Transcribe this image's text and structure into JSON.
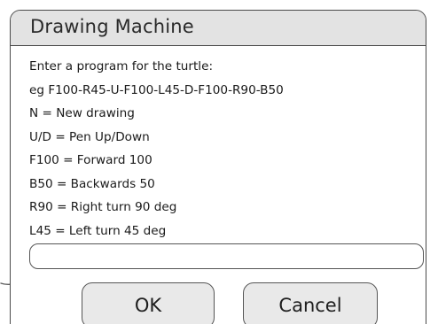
{
  "dialog": {
    "title": "Drawing Machine",
    "instructions": [
      "Enter a program for the turtle:",
      "eg F100-R45-U-F100-L45-D-F100-R90-B50",
      "N = New drawing",
      "U/D = Pen Up/Down",
      "F100 = Forward 100",
      "B50 = Backwards 50",
      "R90 = Right turn 90 deg",
      "L45 = Left turn 45 deg"
    ],
    "program_input": {
      "value": "",
      "placeholder": ""
    },
    "buttons": {
      "ok_label": "OK",
      "cancel_label": "Cancel"
    }
  },
  "annotation": {
    "icon": "hand-drawn-arrow-icon"
  }
}
